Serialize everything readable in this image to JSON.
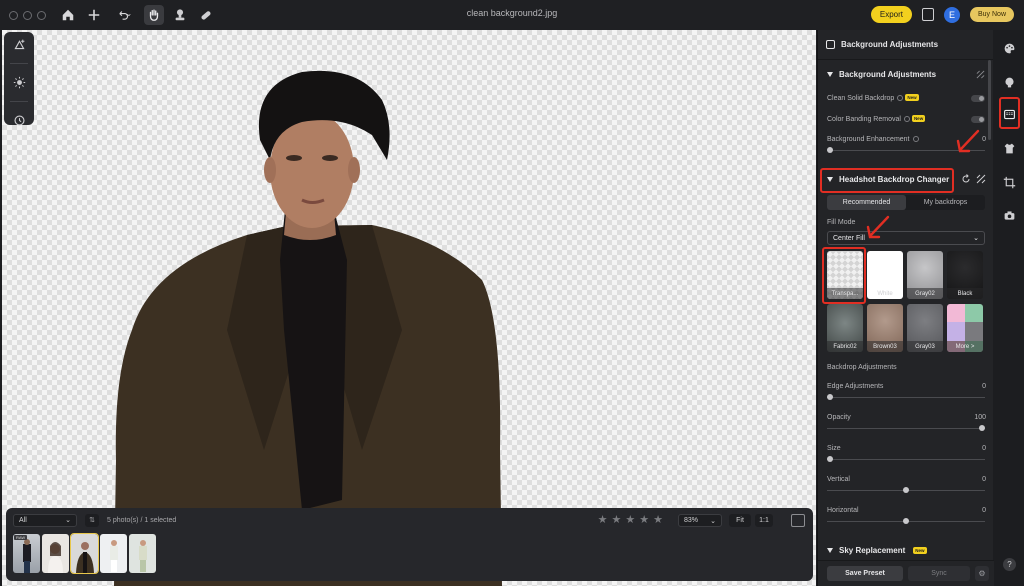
{
  "window": {
    "title": "clean background2.jpg"
  },
  "toolbar": {
    "export_label": "Export",
    "avatar_initial": "E",
    "buy_label": "Buy Now"
  },
  "filmstrip": {
    "filter_value": "All",
    "photo_count": "5 photo(s) / 1 selected",
    "rating_stars": 5,
    "zoom_value": "83%",
    "fit_label": "Fit",
    "one_to_one_label": "1:1",
    "raw_tag": "RAW"
  },
  "panel": {
    "title": "Background Adjustments",
    "bg_section": {
      "title": "Background Adjustments",
      "clean_solid_label": "Clean Solid Backdrop",
      "color_banding_label": "Color Banding Removal",
      "new_badge": "New",
      "enhancement_label": "Background Enhancement",
      "enhancement_value": "0"
    },
    "headshot_section": {
      "title": "Headshot Backdrop Changer",
      "tab_recommended": "Recommended",
      "tab_my_backdrops": "My backdrops",
      "fill_mode_label": "Fill Mode",
      "fill_mode_value": "Center Fill",
      "swatches": [
        {
          "label": "Transpa...",
          "color": "#e6e6e6"
        },
        {
          "label": "White",
          "color": "#ffffff"
        },
        {
          "label": "Gray02",
          "color": "#a9a9ab"
        },
        {
          "label": "Black",
          "color": "#1e1e1f"
        },
        {
          "label": "Fabric02",
          "color": "#5c6362"
        },
        {
          "label": "Brown03",
          "color": "#9a8073"
        },
        {
          "label": "Gray03",
          "color": "#6c6d71"
        },
        {
          "label": "More >",
          "color": "#c9a3c4"
        }
      ]
    },
    "backdrop_adjustments": {
      "title": "Backdrop Adjustments",
      "sliders": [
        {
          "label": "Edge Adjustments",
          "value": "0",
          "position": 0
        },
        {
          "label": "Opacity",
          "value": "100",
          "position": 1
        },
        {
          "label": "Size",
          "value": "0",
          "position": 0
        },
        {
          "label": "Vertical",
          "value": "0",
          "position": 0.5
        },
        {
          "label": "Horizontal",
          "value": "0",
          "position": 0.5
        }
      ]
    },
    "sky_section": {
      "title": "Sky Replacement",
      "new_badge": "New"
    },
    "footer": {
      "save_preset": "Save Preset",
      "sync": "Sync"
    }
  },
  "rail": {
    "help": "?"
  },
  "colors": {
    "accent_yellow": "#f2d01e",
    "annotation_red": "#e12e23",
    "panel_bg": "#232427"
  }
}
